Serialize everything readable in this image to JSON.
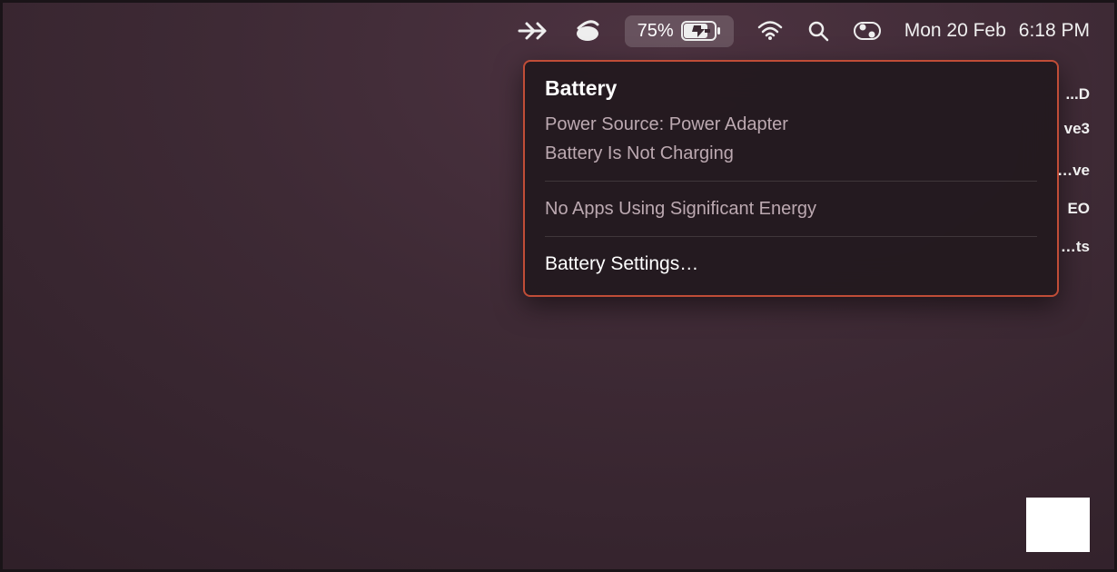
{
  "menubar": {
    "battery_pct": "75%",
    "date": "Mon 20 Feb",
    "time": "6:18 PM"
  },
  "panel": {
    "title": "Battery",
    "power_source": "Power Source: Power Adapter",
    "status": "Battery Is Not Charging",
    "apps_energy": "No Apps Using Significant Energy",
    "settings": "Battery Settings…"
  },
  "edge": {
    "l1": "...D",
    "l2": "ve3",
    "l3": "…ve",
    "l4": "EO",
    "l5": "…ts"
  }
}
